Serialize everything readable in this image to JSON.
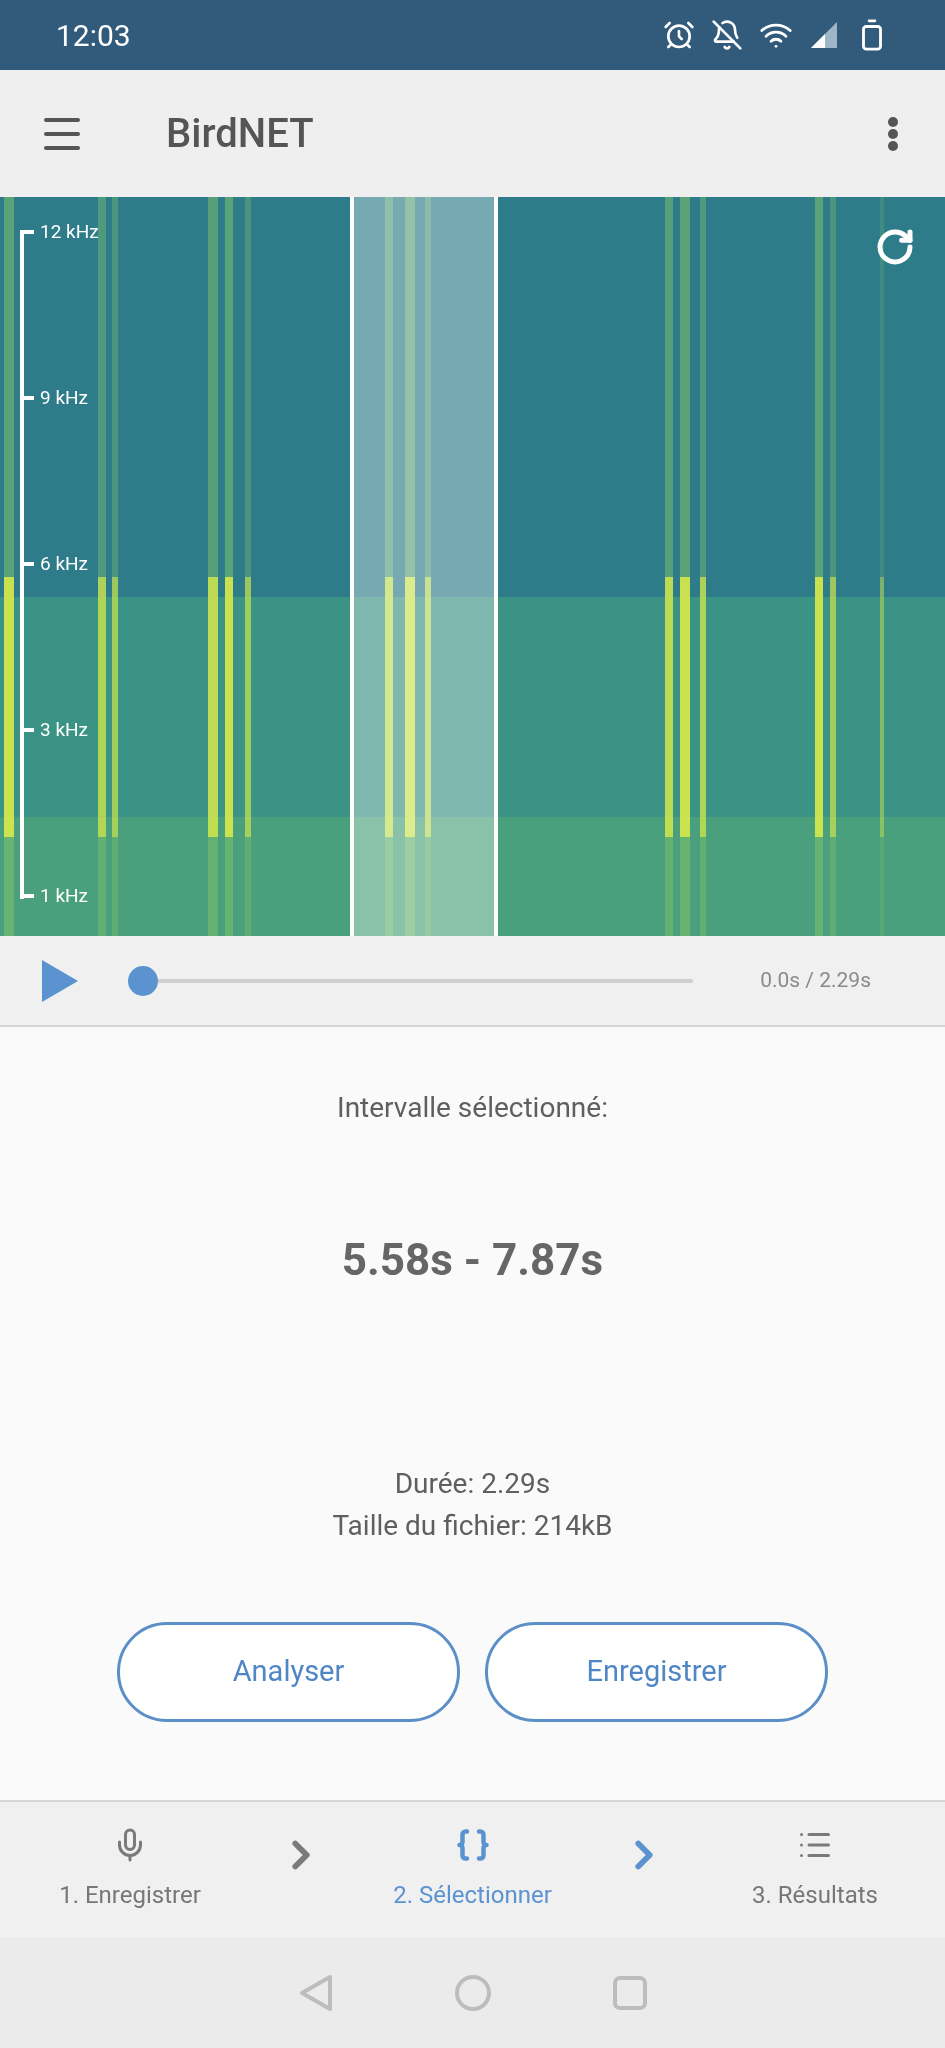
{
  "status_bar": {
    "time": "12:03"
  },
  "app_bar": {
    "title": "BirdNET"
  },
  "spectrogram": {
    "axis_labels": [
      "12 kHz",
      "9 kHz",
      "6 kHz",
      "3 kHz",
      "1 kHz"
    ]
  },
  "player": {
    "level": 0,
    "time": "0.0s / 2.29s"
  },
  "selection": {
    "heading": "Intervalle sélectionné:",
    "range": "5.58s - 7.87s",
    "duration": "Durée: 2.29s",
    "file_size": "Taille du fichier: 214kB"
  },
  "buttons": [
    "Analyser",
    "Enregistrer"
  ],
  "steps": [
    {
      "kind": "record",
      "label": "1. Enregistrer",
      "selected": false
    },
    {
      "kind": "select",
      "label": "2. Sélectionner",
      "selected": true
    },
    {
      "kind": "results",
      "label": "3. Résultats",
      "selected": false
    }
  ]
}
